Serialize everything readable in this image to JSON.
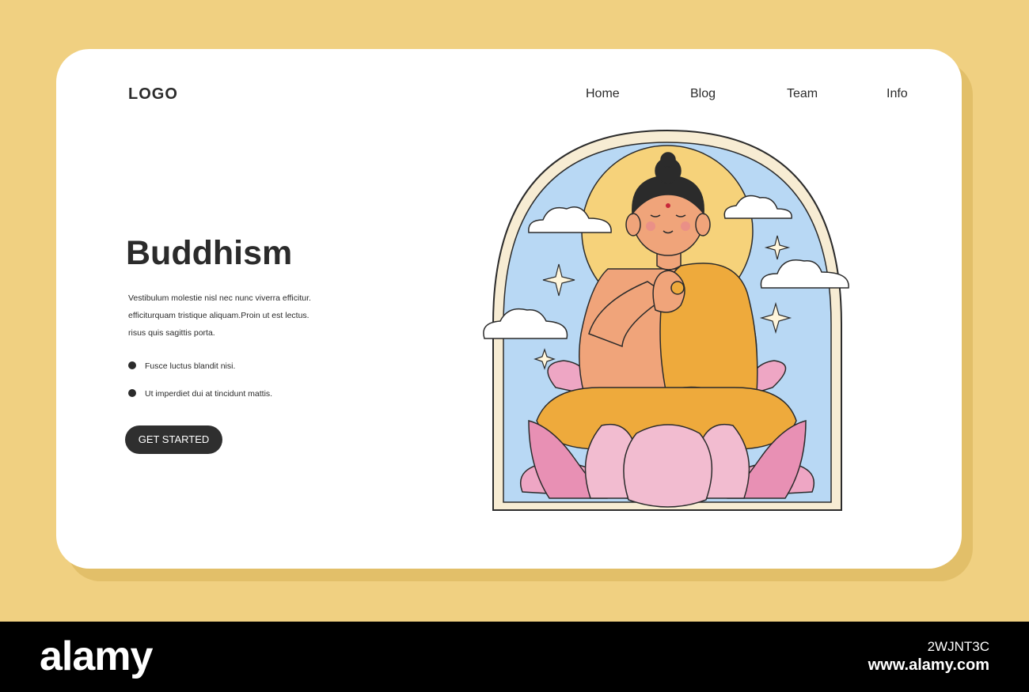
{
  "header": {
    "logo": "LOGO",
    "nav": [
      "Home",
      "Blog",
      "Team",
      "Info"
    ]
  },
  "hero": {
    "title": "Buddhism",
    "paragraph_lines": [
      "Vestibulum molestie nisl nec nunc viverra efficitur.",
      "efficiturquam tristique aliquam.Proin ut est lectus.",
      "risus quis sagittis porta."
    ],
    "bullets": [
      "Fusce luctus blandit nisi.",
      "Ut imperdiet dui at tincidunt mattis."
    ],
    "cta_label": "GET STARTED"
  },
  "illustration": {
    "subject": "meditating-buddha-on-lotus"
  },
  "footer": {
    "brand": "alamy",
    "image_code": "2WJNT3C",
    "site": "www.alamy.com"
  },
  "colors": {
    "background": "#f0d081",
    "card": "#ffffff",
    "text": "#2b2b2b",
    "button": "#2f2f2f",
    "sky": "#b8d8f4",
    "halo": "#f6d27a",
    "robe": "#eeaa3c",
    "lotus": "#eea6c4"
  }
}
